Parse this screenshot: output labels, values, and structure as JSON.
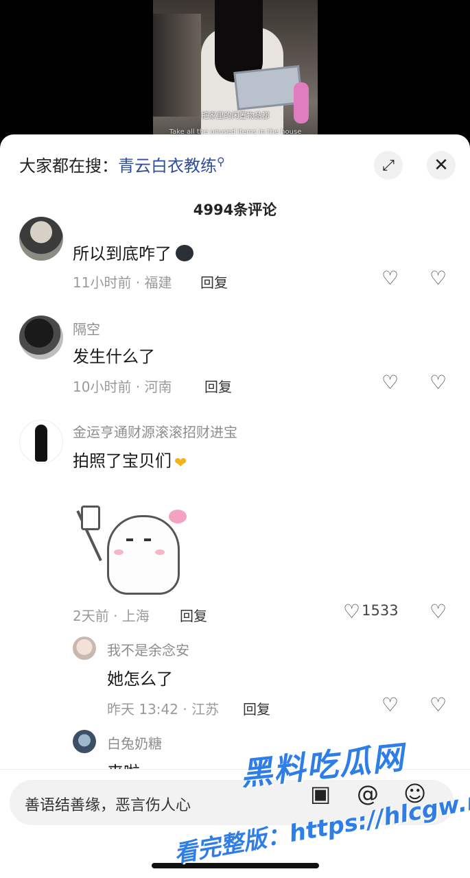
{
  "video": {
    "subtitle_cn": "把家里的闲置物品都",
    "subtitle_en": "Take all the unused items in the house"
  },
  "search": {
    "prefix": "大家都在搜：",
    "keyword": "青云白衣教练",
    "search_icon": "search-icon"
  },
  "header": {
    "expand_icon": "expand-icon",
    "close_icon": "close-icon",
    "comment_count": "4994条评论"
  },
  "comments": [
    {
      "username": "",
      "text": "所以到底咋了",
      "meta": "11小时前 · 福建",
      "reply_label": "回复",
      "likes": ""
    },
    {
      "username": "隔空",
      "text": "发生什么了",
      "meta": "10小时前 · 河南",
      "reply_label": "回复",
      "likes": ""
    },
    {
      "username": "金运亨通财源滚滚招财进宝",
      "text": "拍照了宝贝们",
      "meta": "2天前 · 上海",
      "reply_label": "回复",
      "likes": "1533"
    }
  ],
  "replies": [
    {
      "username": "我不是余念安",
      "text": "她怎么了",
      "meta": "昨天 13:42 · 江苏",
      "reply_label": "回复",
      "likes": ""
    },
    {
      "username": "白兔奶糖",
      "text": "来啦"
    }
  ],
  "input": {
    "placeholder": "善语结善缘，恶言伤人心",
    "icons": [
      "image-icon",
      "at-icon",
      "emoji-icon"
    ]
  },
  "watermark": {
    "line1": "黑料吃瓜网",
    "line2": "看完整版：https://hlcgw.net"
  },
  "colors": {
    "search_keyword": "#2f4f9c",
    "watermark": "#2f7ee8"
  }
}
